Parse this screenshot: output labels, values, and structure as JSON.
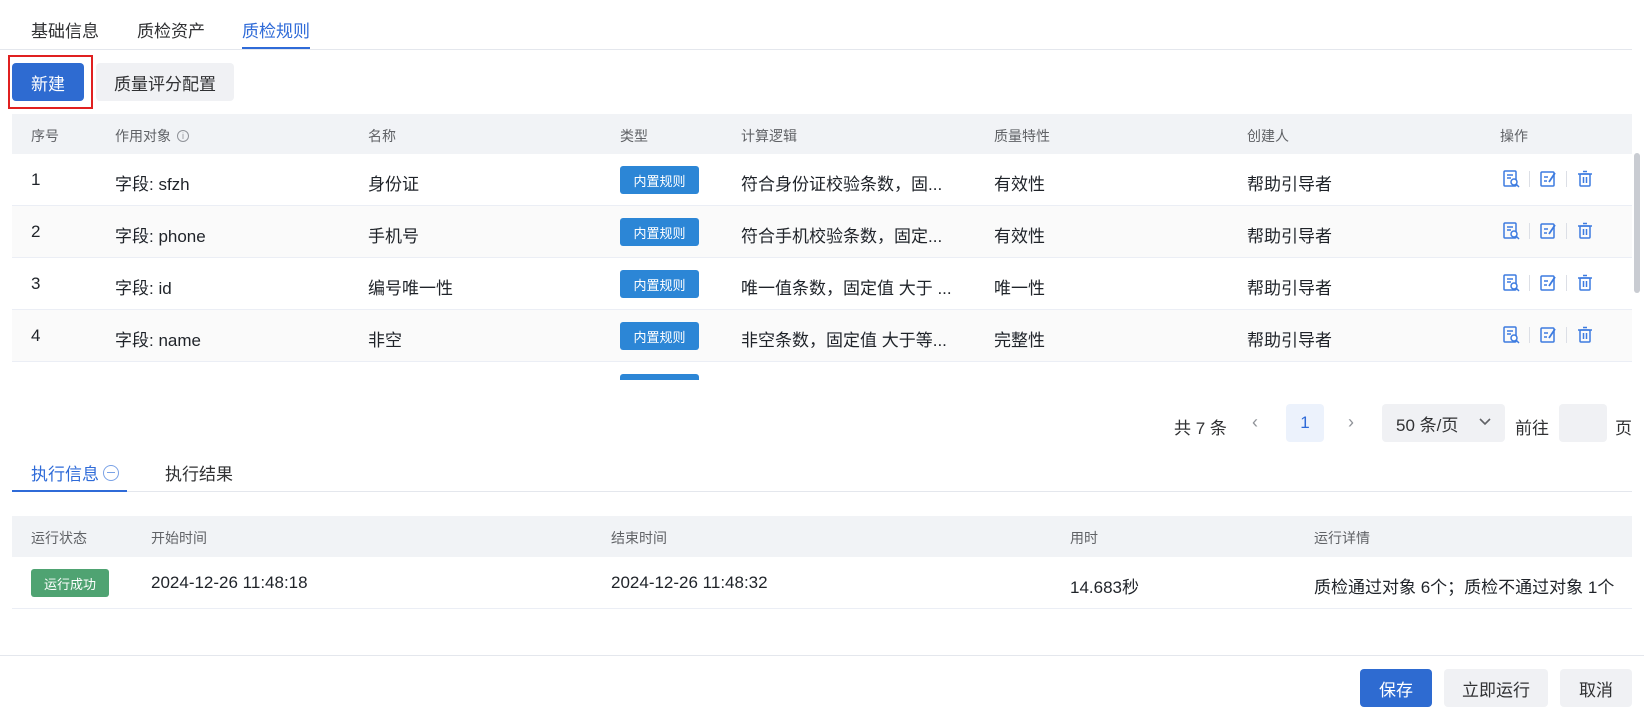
{
  "top_tabs": [
    {
      "label": "基础信息",
      "active": false
    },
    {
      "label": "质检资产",
      "active": false
    },
    {
      "label": "质检规则",
      "active": true
    }
  ],
  "toolbar": {
    "new_label": "新建",
    "score_config_label": "质量评分配置"
  },
  "rules_table": {
    "headers": [
      "序号",
      "作用对象",
      "名称",
      "类型",
      "计算逻辑",
      "质量特性",
      "创建人",
      "操作"
    ],
    "rows": [
      {
        "index": "1",
        "target": "字段: sfzh",
        "name": "身份证",
        "type": "内置规则",
        "logic": "符合身份证校验条数，固...",
        "feature": "有效性",
        "creator": "帮助引导者"
      },
      {
        "index": "2",
        "target": "字段: phone",
        "name": "手机号",
        "type": "内置规则",
        "logic": "符合手机校验条数，固定...",
        "feature": "有效性",
        "creator": "帮助引导者"
      },
      {
        "index": "3",
        "target": "字段: id",
        "name": "编号唯一性",
        "type": "内置规则",
        "logic": "唯一值条数，固定值 大于 ...",
        "feature": "唯一性",
        "creator": "帮助引导者"
      },
      {
        "index": "4",
        "target": "字段: name",
        "name": "非空",
        "type": "内置规则",
        "logic": "非空条数，固定值 大于等...",
        "feature": "完整性",
        "creator": "帮助引导者"
      }
    ],
    "op_icons": [
      "view-icon",
      "edit-icon",
      "delete-icon"
    ]
  },
  "pagination": {
    "total_label": "共 7 条",
    "current_page": "1",
    "page_size_label": "50 条/页",
    "goto_label": "前往",
    "page_suffix": "页"
  },
  "exec_tabs": [
    {
      "label": "执行信息",
      "active": true
    },
    {
      "label": "执行结果",
      "active": false
    }
  ],
  "exec_table": {
    "headers": [
      "运行状态",
      "开始时间",
      "结束时间",
      "用时",
      "运行详情"
    ],
    "row": {
      "status": "运行成功",
      "start": "2024-12-26 11:48:18",
      "end": "2024-12-26 11:48:32",
      "duration": "14.683秒",
      "detail": "质检通过对象 6个；质检不通过对象 1个"
    }
  },
  "footer": {
    "save_label": "保存",
    "run_label": "立即运行",
    "cancel_label": "取消"
  },
  "colors": {
    "primary": "#2e6bd1",
    "tag_blue": "#2c86d6",
    "success_green": "#4fa372",
    "highlight_red": "#e02020"
  }
}
